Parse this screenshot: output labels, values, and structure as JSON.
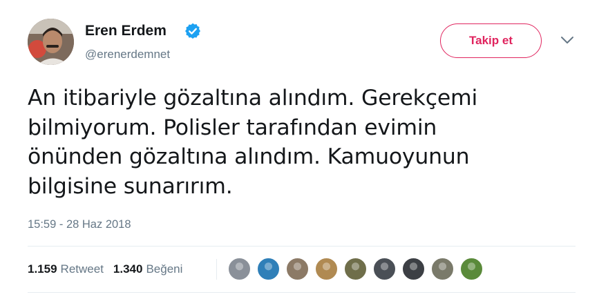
{
  "user": {
    "display_name": "Eren Erdem",
    "handle": "@erenerdemnet",
    "verified": true,
    "avatar_icon": "profile-photo"
  },
  "actions": {
    "follow_label": "Takip et",
    "menu_icon": "chevron-down-icon"
  },
  "tweet": {
    "lines": [
      "An itibariyle gözaltına alındım. Gerekçemi",
      "bilmiyorum. Polisler tarafından evimin",
      "önünden gözaltına alındım. Kamuoyunun",
      "bilgisine sunarırım."
    ],
    "timestamp": "15:59 - 28 Haz 2018"
  },
  "stats": {
    "retweets": {
      "count": "1.159",
      "label": "Retweet"
    },
    "likes": {
      "count": "1.340",
      "label": "Beğeni"
    }
  },
  "likers": [
    {
      "name": "liker-avatar-1",
      "color": "#8a9099"
    },
    {
      "name": "liker-avatar-2",
      "color": "#2f7fb8"
    },
    {
      "name": "liker-avatar-3",
      "color": "#8c7a66"
    },
    {
      "name": "liker-avatar-4",
      "color": "#b08a52"
    },
    {
      "name": "liker-avatar-5",
      "color": "#6f6e4a"
    },
    {
      "name": "liker-avatar-6",
      "color": "#4a4f56"
    },
    {
      "name": "liker-avatar-7",
      "color": "#3c3f44"
    },
    {
      "name": "liker-avatar-8",
      "color": "#7a7a6a"
    },
    {
      "name": "liker-avatar-9",
      "color": "#5a8a3a"
    }
  ],
  "colors": {
    "accent": "#e0245e",
    "verified": "#1da1f2",
    "secondary_text": "#657786",
    "primary_text": "#14171a",
    "divider": "#e6ecf0"
  }
}
